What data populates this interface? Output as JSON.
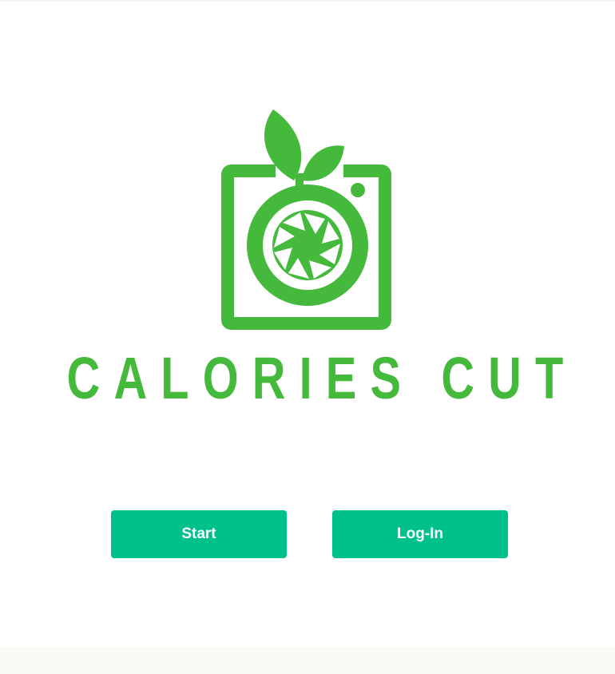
{
  "brand": {
    "name": "CALORIES CUT",
    "logo_icon": "camera-apple-icon",
    "color": "#44b93c"
  },
  "actions": {
    "start_label": "Start",
    "login_label": "Log-In",
    "button_color": "#00c08b"
  }
}
